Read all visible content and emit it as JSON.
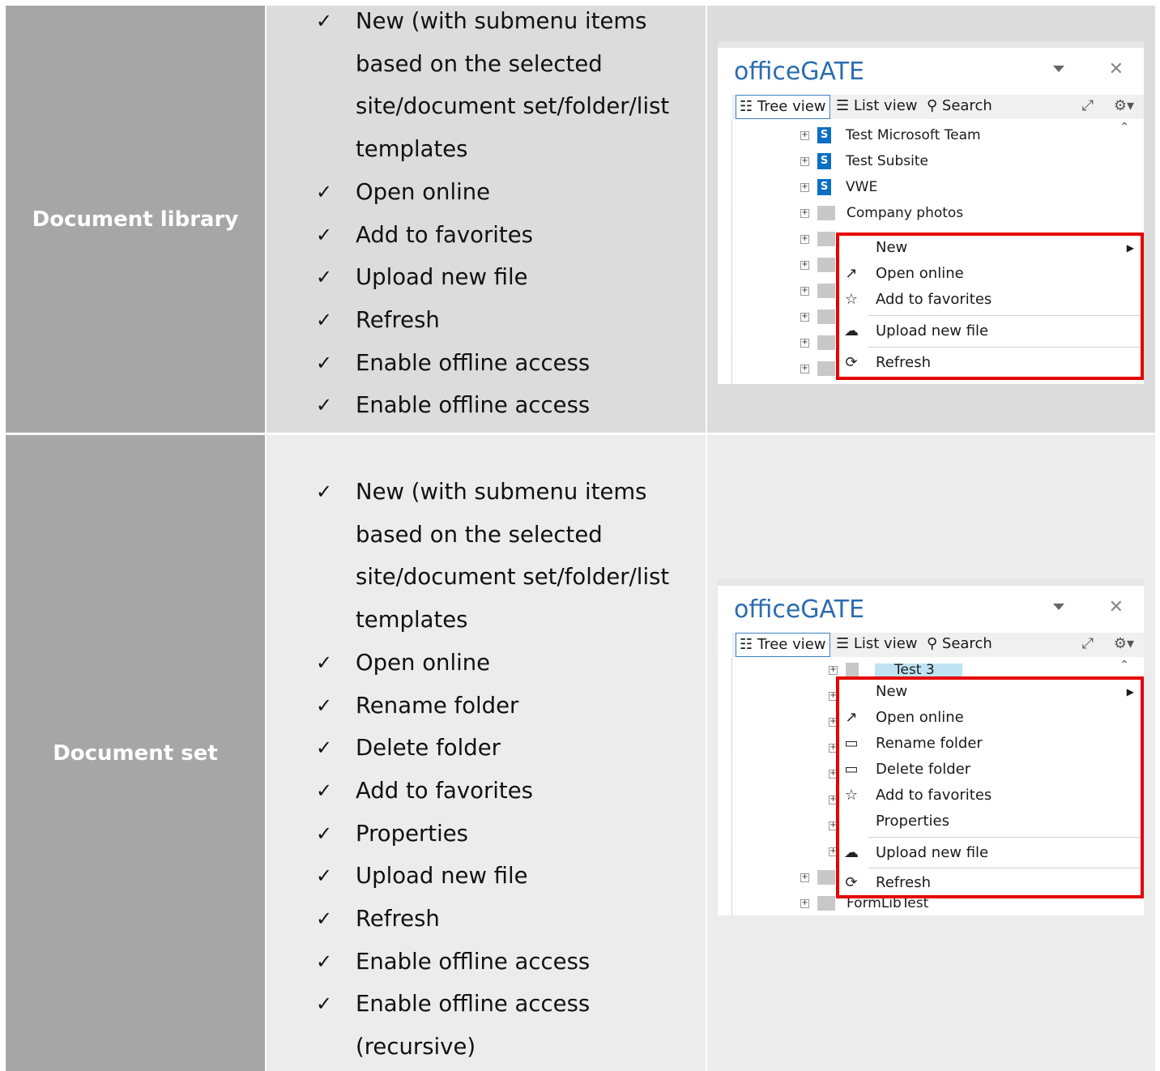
{
  "rows": [
    {
      "label": "Document library",
      "items": [
        "New (with submenu items based on the selected site/document set/folder/list templates",
        "Open online",
        "Add to favorites",
        "Upload new file",
        "Refresh",
        "Enable offline access",
        "Enable offline access (recursive)"
      ],
      "panel": {
        "brand": "officeGATE",
        "toolbar": {
          "tree": "Tree view",
          "list": "List view",
          "search": "Search"
        },
        "tree": [
          "Test Microsoft Team",
          "Test Subsite",
          "VWE",
          "Company photos"
        ],
        "menu": [
          "New",
          "Open online",
          "Add to favorites",
          "Upload new file",
          "Refresh"
        ]
      }
    },
    {
      "label": "Document set",
      "items": [
        "New (with submenu items based on the selected site/document set/folder/list templates",
        "Open online",
        "Rename folder",
        "Delete folder",
        "Add to favorites",
        "Properties",
        "Upload new file",
        "Refresh",
        "Enable offline access",
        "Enable offline access (recursive)"
      ],
      "panel": {
        "brand": "officeGATE",
        "toolbar": {
          "tree": "Tree view",
          "list": "List view",
          "search": "Search"
        },
        "selected_node": "Test 3",
        "last_node": "FormLibTest",
        "menu": [
          "New",
          "Open online",
          "Rename folder",
          "Delete folder",
          "Add to favorites",
          "Properties",
          "Upload new file",
          "Refresh"
        ]
      }
    }
  ],
  "icons": {
    "check": "check-icon",
    "menu_icons": [
      "open-external-icon",
      "star-icon",
      "cloud-upload-icon",
      "refresh-icon",
      "folder-rename-icon",
      "folder-delete-icon"
    ]
  }
}
